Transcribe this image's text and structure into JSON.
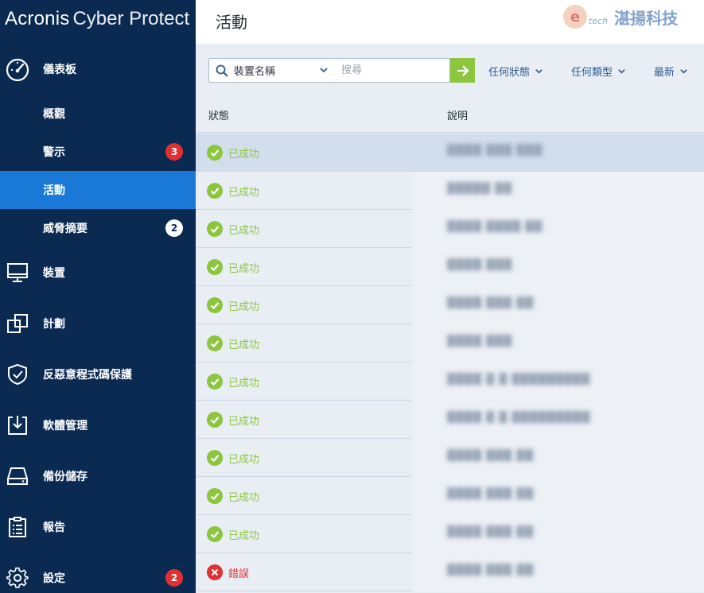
{
  "brand": {
    "name": "Acronis",
    "product": "Cyber Protect"
  },
  "sidebar": {
    "dashboard": {
      "label": "儀表板",
      "icon": "dashboard-gauge-icon"
    },
    "sub_items": [
      {
        "label": "概觀",
        "badge": ""
      },
      {
        "label": "警示",
        "badge": "3",
        "badge_color": "#e03031"
      },
      {
        "label": "活動",
        "badge": "",
        "active": true
      },
      {
        "label": "威脅摘要",
        "badge": "2",
        "badge_color": "#ffffff"
      }
    ],
    "items": [
      {
        "label": "裝置",
        "icon": "monitor-icon"
      },
      {
        "label": "計劃",
        "icon": "plans-icon"
      },
      {
        "label": "反惡意程式碼保護",
        "icon": "shield-check-icon"
      },
      {
        "label": "軟體管理",
        "icon": "software-download-icon"
      },
      {
        "label": "備份儲存",
        "icon": "storage-drive-icon"
      },
      {
        "label": "報告",
        "icon": "clipboard-report-icon"
      },
      {
        "label": "設定",
        "icon": "gear-icon",
        "badge": "2"
      }
    ],
    "colors": {
      "background": "#0b2a52",
      "active": "#1a78d6"
    }
  },
  "header": {
    "title": "活動",
    "watermark": "湛揚科技",
    "watermark_sub": "tech"
  },
  "toolbar": {
    "device_filter": "裝置名稱",
    "search_placeholder": "搜尋",
    "status_filter": "任何狀態",
    "type_filter": "任何類型",
    "sort": "最新",
    "go_color": "#8cc63f"
  },
  "table": {
    "columns": [
      "狀態",
      "說明"
    ],
    "rows": [
      {
        "status": "已成功",
        "kind": "ok",
        "desc": "████ ███ ███"
      },
      {
        "status": "已成功",
        "kind": "ok",
        "desc": "█████ ██"
      },
      {
        "status": "已成功",
        "kind": "ok",
        "desc": "████ ████ ██"
      },
      {
        "status": "已成功",
        "kind": "ok",
        "desc": "████ ███"
      },
      {
        "status": "已成功",
        "kind": "ok",
        "desc": "████ ███ ██"
      },
      {
        "status": "已成功",
        "kind": "ok",
        "desc": "████ ███"
      },
      {
        "status": "已成功",
        "kind": "ok",
        "desc": "████ █ █ █████████"
      },
      {
        "status": "已成功",
        "kind": "ok",
        "desc": "████ █ █ █████████"
      },
      {
        "status": "已成功",
        "kind": "ok",
        "desc": "████ ███ ██"
      },
      {
        "status": "已成功",
        "kind": "ok",
        "desc": "████ ███ ██"
      },
      {
        "status": "已成功",
        "kind": "ok",
        "desc": "████ ███ ██"
      },
      {
        "status": "錯誤",
        "kind": "err",
        "desc": "████ ███ ██"
      }
    ],
    "status_colors": {
      "ok": "#8cc63f",
      "err": "#e03031"
    }
  }
}
